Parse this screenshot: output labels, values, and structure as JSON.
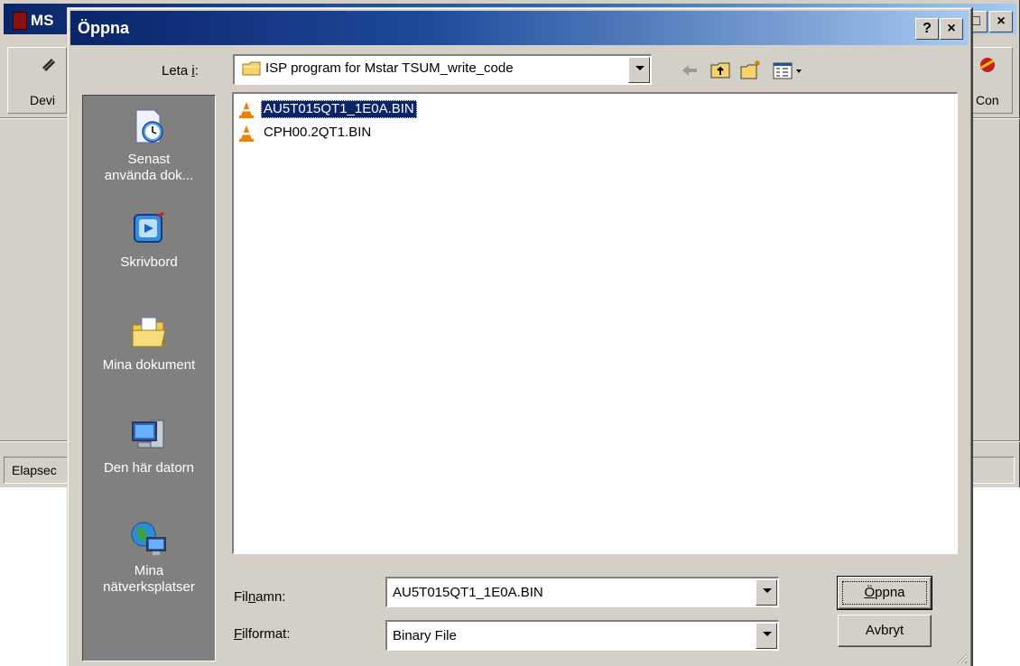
{
  "background_app": {
    "title": "MS",
    "toolbar": {
      "left_button_label": "Devi",
      "right_button_label": "Con"
    },
    "status": {
      "elapsed_label": "Elapsec"
    }
  },
  "dialog": {
    "title": "Öppna",
    "help_button": "?",
    "close_button": "×",
    "look_in": {
      "label_pre": "Leta ",
      "label_accel": "i",
      "label_post": ":",
      "value": "ISP program for Mstar TSUM_write_code"
    },
    "toolbar_icons": [
      "back-arrow-icon",
      "up-one-level-icon",
      "new-folder-icon",
      "view-menu-icon"
    ],
    "places": [
      {
        "icon": "recent-documents-icon",
        "label_line1": "Senast",
        "label_line2": "använda dok..."
      },
      {
        "icon": "desktop-icon",
        "label_line1": "Skrivbord",
        "label_line2": ""
      },
      {
        "icon": "my-documents-icon",
        "label_line1": "Mina dokument",
        "label_line2": ""
      },
      {
        "icon": "my-computer-icon",
        "label_line1": "Den här datorn",
        "label_line2": ""
      },
      {
        "icon": "network-places-icon",
        "label_line1": "Mina",
        "label_line2": "nätverksplatser"
      }
    ],
    "files": [
      {
        "name": "AU5T015QT1_1E0A.BIN",
        "selected": true,
        "icon": "vlc-cone-icon"
      },
      {
        "name": "CPH00.2QT1.BIN",
        "selected": false,
        "icon": "vlc-cone-icon"
      }
    ],
    "filename": {
      "label_pre": "Fil",
      "label_accel": "n",
      "label_post": "amn:",
      "value": "AU5T015QT1_1E0A.BIN"
    },
    "filetype": {
      "label_pre": "",
      "label_accel": "F",
      "label_post": "ilformat:",
      "value": "Binary File"
    },
    "open_button": {
      "accel": "Ö",
      "rest": "ppna"
    },
    "cancel_button": "Avbryt"
  }
}
